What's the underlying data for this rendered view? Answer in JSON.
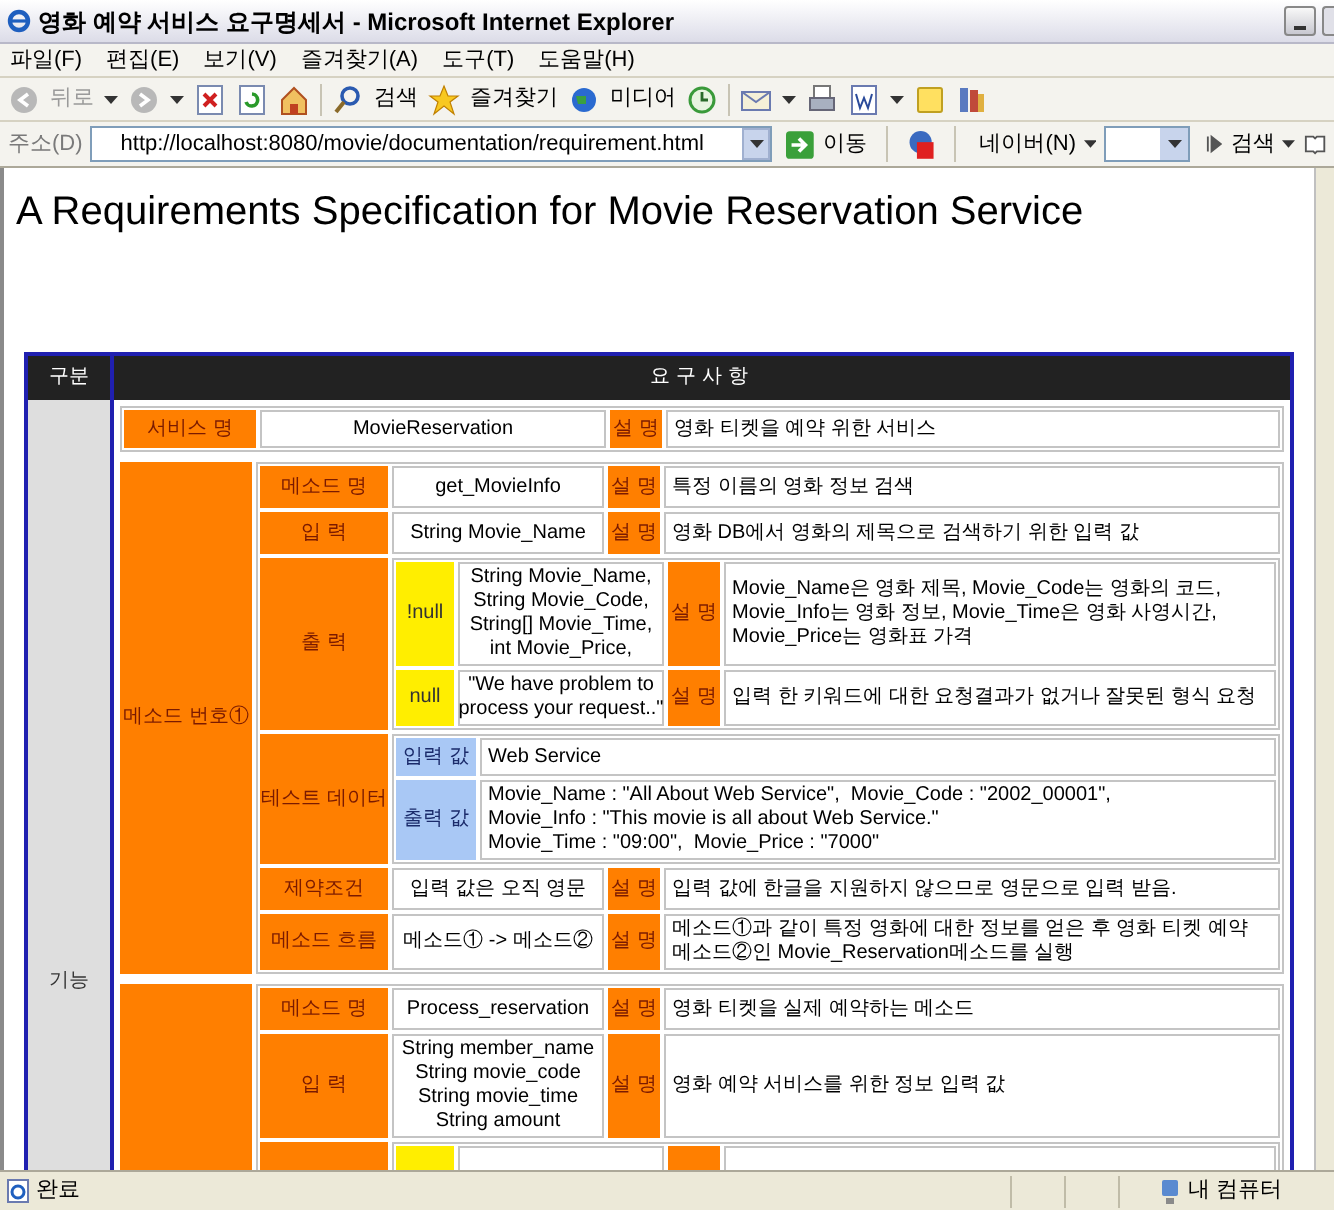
{
  "window": {
    "title": "영화 예약 서비스 요구명세서 - Microsoft Internet Explorer"
  },
  "menu": [
    "파일(F)",
    "편집(E)",
    "보기(V)",
    "즐겨찾기(A)",
    "도구(T)",
    "도움말(H)"
  ],
  "toolbar": {
    "back": {
      "label": "뒤로",
      "disabled": true
    },
    "search": "검색",
    "favorites": "즐겨찾기",
    "media": "미디어"
  },
  "address": {
    "label": "주소(D)",
    "url": "http://localhost:8080/movie/documentation/requirement.html",
    "go": "이동"
  },
  "links": {
    "naver": "네이버(N)",
    "search": "검색"
  },
  "heading": "A Requirements Specification for Movie Reservation Service",
  "table": {
    "columns": [
      "구분",
      "요구사항"
    ],
    "category": "기능",
    "service": {
      "label": "서비스 명",
      "value": "MovieReservation",
      "desc_label": "설 명",
      "desc": "영화 티켓을 예약 위한 서비스"
    },
    "methods": [
      {
        "label": "메소드 번호①",
        "rows": [
          {
            "kind": "simple",
            "label": "메소드 명",
            "value": "get_MovieInfo",
            "desc_label": "설 명",
            "desc": "특정 이름의 영화 정보 검색"
          },
          {
            "kind": "simple",
            "label": "입 력",
            "value": "String Movie_Name",
            "desc_label": "설 명",
            "desc": "영화 DB에서 영화의 제목으로 검색하기 위한 입력 값"
          },
          {
            "kind": "output",
            "label": "출 력",
            "cases": [
              {
                "flag": "!null",
                "value": "String Movie_Name,\nString Movie_Code,\nString[] Movie_Time,\nint Movie_Price,",
                "desc_label": "설 명",
                "desc": "Movie_Name은 영화 제목, Movie_Code는 영화의 코드,\nMovie_Info는 영화 정보, Movie_Time은 영화 사영시간,\nMovie_Price는 영화표 가격"
              },
              {
                "flag": "null",
                "value": "\"We have problem to\nprocess your request..\"",
                "desc_label": "설 명",
                "desc": "입력 한 키워드에 대한 요청결과가 없거나 잘못된 형식 요청"
              }
            ]
          },
          {
            "kind": "test",
            "label": "테스트 데이터",
            "items": [
              {
                "label": "입력 값",
                "value": "Web Service"
              },
              {
                "label": "출력 값",
                "value": "Movie_Name : \"All About Web Service\",  Movie_Code : \"2002_00001\",\nMovie_Info : \"This movie is all about Web Service.\"\nMovie_Time : \"09:00\",  Movie_Price : \"7000\""
              }
            ]
          },
          {
            "kind": "simple",
            "label": "제약조건",
            "value": "입력 값은 오직 영문",
            "desc_label": "설 명",
            "desc": "입력 값에 한글을 지원하지 않으므로 영문으로 입력 받음."
          },
          {
            "kind": "simple",
            "label": "메소드 흐름",
            "value": "메소드① -> 메소드②",
            "desc_label": "설 명",
            "desc": "메소드①과 같이 특정 영화에 대한 정보를 얻은 후 영화 티켓 예약\n메소드②인 Movie_Reservation메소드를 실행"
          }
        ]
      },
      {
        "rows": [
          {
            "kind": "simple",
            "label": "메소드 명",
            "value": "Process_reservation",
            "desc_label": "설 명",
            "desc": "영화 티켓을 실제 예약하는 메소드"
          },
          {
            "kind": "simple",
            "label": "입 력",
            "value": "String member_name\nString movie_code\nString movie_time\nString amount",
            "desc_label": "설 명",
            "desc": "영화 예약 서비스를 위한 정보 입력 값"
          },
          {
            "kind": "output"
          }
        ]
      }
    ]
  },
  "status": {
    "text": "완료",
    "zone": "내 컴퓨터"
  }
}
